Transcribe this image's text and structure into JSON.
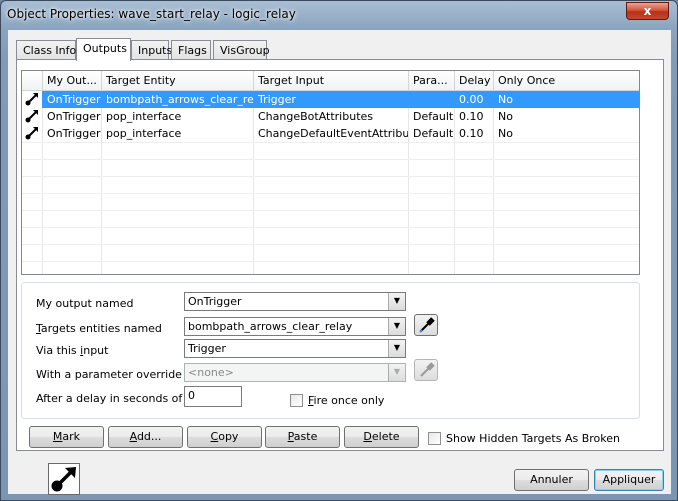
{
  "window": {
    "title": "Object Properties: wave_start_relay - logic_relay",
    "close_glyph": "x"
  },
  "tabs": [
    {
      "label": "Class Info",
      "active": false
    },
    {
      "label": "Outputs",
      "active": true
    },
    {
      "label": "Inputs",
      "active": false
    },
    {
      "label": "Flags",
      "active": false
    },
    {
      "label": "VisGroup",
      "active": false
    }
  ],
  "grid": {
    "columns": [
      "",
      "My Out...",
      "Target Entity",
      "Target Input",
      "Para...",
      "Delay",
      "Only Once"
    ],
    "rows": [
      {
        "icon": "output-connection-icon",
        "output": "OnTrigger",
        "target_entity": "bombpath_arrows_clear_relay",
        "target_input": "Trigger",
        "parameter": "",
        "delay": "0.00",
        "only_once": "No",
        "selected": true
      },
      {
        "icon": "output-connection-icon",
        "output": "OnTrigger",
        "target_entity": "pop_interface",
        "target_input": "ChangeBotAttributes",
        "parameter": "Default",
        "delay": "0.10",
        "only_once": "No",
        "selected": false
      },
      {
        "icon": "output-connection-icon",
        "output": "OnTrigger",
        "target_entity": "pop_interface",
        "target_input": "ChangeDefaultEventAttributes",
        "parameter": "Default",
        "delay": "0.10",
        "only_once": "No",
        "selected": false
      }
    ]
  },
  "form": {
    "output_label": "My output named",
    "output_value": "OnTrigger",
    "targets_label_rest": "argets entities named",
    "targets_label_key": "T",
    "targets_value": "bombpath_arrows_clear_relay",
    "input_label_pre": "Via this ",
    "input_label_key": "i",
    "input_label_rest": "nput",
    "input_value": "Trigger",
    "param_label": "With a parameter override of",
    "param_value": "<none>",
    "delay_label": "After a delay in seconds of",
    "delay_value": "0",
    "fire_once_key": "F",
    "fire_once_rest": "ire once only",
    "fire_once_checked": false
  },
  "actions": {
    "mark_key": "M",
    "mark_rest": "ark",
    "add_key": "A",
    "add_rest": "dd...",
    "copy_key": "C",
    "copy_rest": "opy",
    "paste_key": "P",
    "paste_rest": "aste",
    "delete_key": "D",
    "delete_rest": "elete",
    "show_hidden_label": "Show Hidden Targets As Broken",
    "show_hidden_checked": false
  },
  "footer": {
    "cancel_label": "Annuler",
    "apply_label": "Appliquer"
  },
  "colors": {
    "selection": "#3399ff",
    "icon_color": "#000000"
  }
}
